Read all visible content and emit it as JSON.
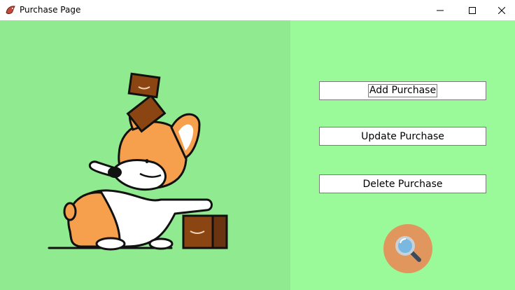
{
  "window": {
    "title": "Purchase Page",
    "app_icon": "fish-icon",
    "controls": [
      "minimize-icon",
      "maximize-icon",
      "close-icon"
    ]
  },
  "illustration": {
    "subject": "corgi-with-boxes"
  },
  "actions": {
    "add_label": "Add Purchase",
    "update_label": "Update Purchase",
    "delete_label": "Delete Purchase"
  },
  "search": {
    "icon": "magnifier-icon"
  },
  "colors": {
    "left_bg": "#90ea8f",
    "right_bg": "#9af998",
    "search_circle": "#e0965c",
    "box_brown": "#8b4513"
  }
}
